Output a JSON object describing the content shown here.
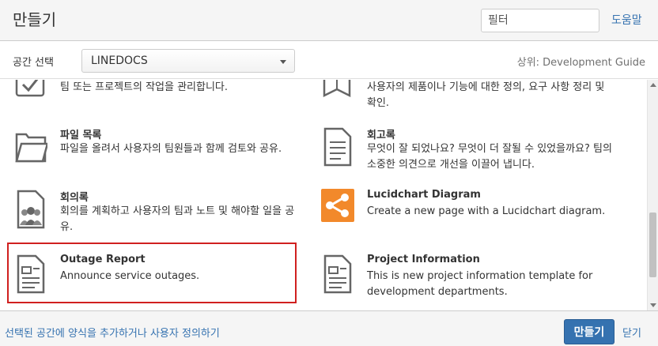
{
  "header": {
    "title": "만들기",
    "filter_placeholder": "필터",
    "help_label": "도움말"
  },
  "space": {
    "label": "공간 선택",
    "selected": "LINEDOCS",
    "parent_label": "상위: Development Guide"
  },
  "templates": [
    {
      "name": "",
      "description": "팀 또는 프로젝트의 작업을 관리합니다.",
      "icon": "task-checkbox-icon"
    },
    {
      "name": "",
      "description": "사용자의 제품이나 기능에 대한 정의, 요구 사항 정리 및 확인.",
      "icon": "requirements-book-icon"
    },
    {
      "name": "파일 목록",
      "description": "파일을 올려서 사용자의 팀원들과 함께 검토와 공유.",
      "icon": "folder-icon"
    },
    {
      "name": "회고록",
      "description": "무엇이 잘 되었나요? 무엇이 더 잘될 수 있었을까요? 팀의 소중한 의견으로 개선을 이끌어 냅니다.",
      "icon": "retrospective-doc-icon"
    },
    {
      "name": "회의록",
      "description": "회의를 계획하고 사용자의 팀과 노트 및 해야할 일을 공유.",
      "icon": "meeting-notes-icon"
    },
    {
      "name": "Lucidchart Diagram",
      "description": "Create a new page with a Lucidchart diagram.",
      "icon": "lucidchart-share-icon"
    },
    {
      "name": "Outage Report",
      "description": "Announce service outages.",
      "icon": "page-template-icon"
    },
    {
      "name": "Project Information",
      "description": "This is new project information template for development departments.",
      "icon": "page-template-icon"
    }
  ],
  "colors": {
    "accent": "#3572b0",
    "highlight": "#d0201f",
    "lucid": "#f2892b"
  },
  "footer": {
    "link_label": "선택된 공간에 양식을 추가하거나 사용자 정의하기",
    "create_label": "만들기",
    "close_label": "닫기"
  }
}
